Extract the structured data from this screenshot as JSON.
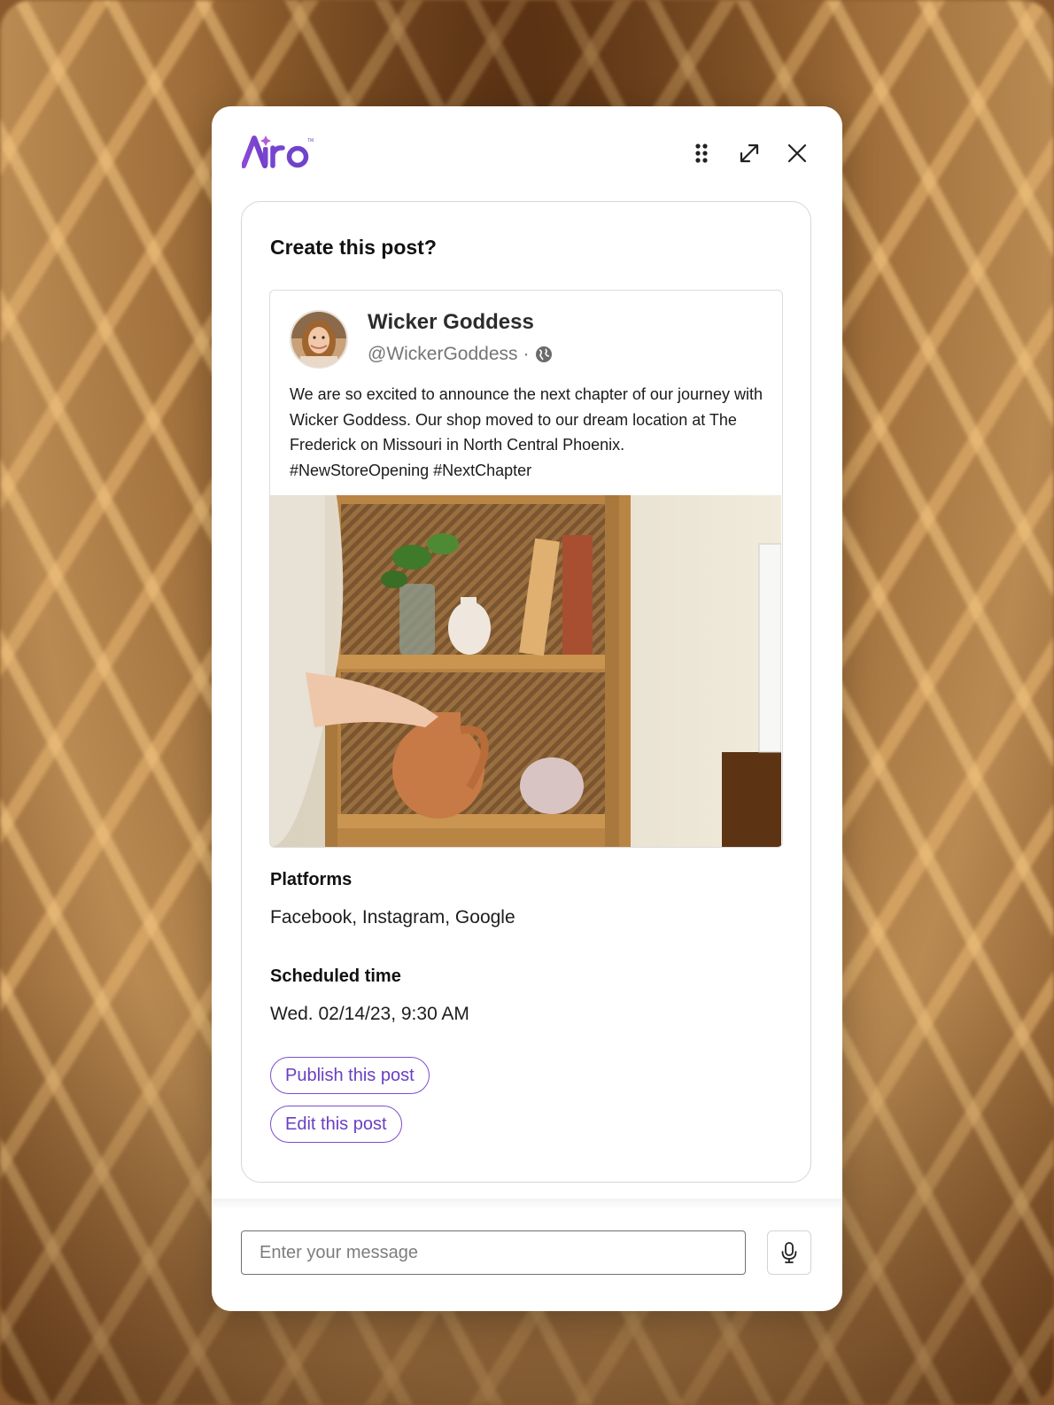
{
  "app": {
    "logo_text": "Airo",
    "brand_color": "#7b4fd0"
  },
  "header": {
    "drag_icon": "drag-handle-icon",
    "expand_icon": "expand-icon",
    "close_icon": "close-icon"
  },
  "card": {
    "title": "Create this post?",
    "post": {
      "author_name": "Wicker Goddess",
      "author_handle": "@WickerGoddess",
      "visibility_separator": "·",
      "visibility_icon": "globe-icon",
      "text": "We are so excited to announce the next chapter of our journey with Wicker Goddess. Our shop moved to our dream location at The Frederick on Missouri in North Central Phoenix. #NewStoreOpening #NextChapter",
      "image_description_icon": "wicker-shelf-photo"
    },
    "platforms": {
      "label": "Platforms",
      "value": "Facebook, Instagram, Google"
    },
    "schedule": {
      "label": "Scheduled time",
      "value": "Wed. 02/14/23, 9:30 AM"
    },
    "actions": {
      "publish_label": "Publish this post",
      "edit_label": "Edit this post"
    }
  },
  "composer": {
    "placeholder": "Enter your message",
    "value": "",
    "mic_icon": "microphone-icon"
  }
}
